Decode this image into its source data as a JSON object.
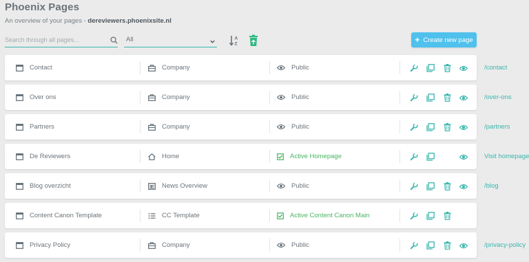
{
  "header": {
    "title": "Phoenix Pages",
    "subtitle_prefix": "An overview of your pages - ",
    "site": "dereviewers.phoenixsite.nl"
  },
  "toolbar": {
    "search_placeholder": "Search through all pages...",
    "filter_value": "All",
    "create_label": "Create new page"
  },
  "colors": {
    "accent": "#38b6ad",
    "primary_button": "#4fc1ec",
    "active_green": "#48b562"
  },
  "pages": [
    {
      "name": "Contact",
      "type": "Company",
      "type_icon": "briefcase-icon",
      "status": "Public",
      "status_active": false,
      "has_delete": true,
      "has_view": true,
      "link": "/contact"
    },
    {
      "name": "Over ons",
      "type": "Company",
      "type_icon": "briefcase-icon",
      "status": "Public",
      "status_active": false,
      "has_delete": true,
      "has_view": true,
      "link": "/over-ons"
    },
    {
      "name": "Partners",
      "type": "Company",
      "type_icon": "briefcase-icon",
      "status": "Public",
      "status_active": false,
      "has_delete": true,
      "has_view": true,
      "link": "/partners"
    },
    {
      "name": "De Reviewers",
      "type": "Home",
      "type_icon": "home-icon",
      "status": "Active Homepage",
      "status_active": true,
      "has_delete": false,
      "has_view": true,
      "link": "Visit homepage"
    },
    {
      "name": "Blog overzicht",
      "type": "News Overview",
      "type_icon": "news-icon",
      "status": "Public",
      "status_active": false,
      "has_delete": true,
      "has_view": true,
      "link": "/blog"
    },
    {
      "name": "Content Canon Template",
      "type": "CC Template",
      "type_icon": "list-icon",
      "status": "Active Content Canon Main",
      "status_active": true,
      "has_delete": true,
      "has_view": false,
      "link": ""
    },
    {
      "name": "Privacy Policy",
      "type": "Company",
      "type_icon": "briefcase-icon",
      "status": "Public",
      "status_active": false,
      "has_delete": true,
      "has_view": true,
      "link": "/privacy-policy"
    }
  ]
}
